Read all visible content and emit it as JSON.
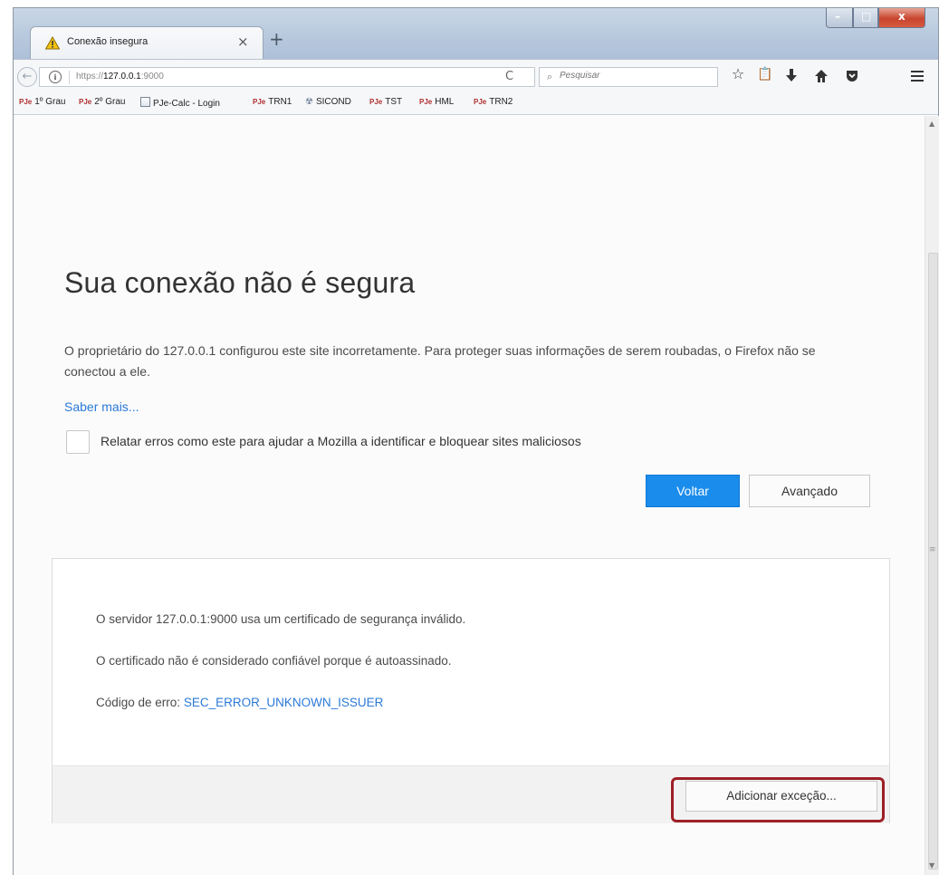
{
  "window": {
    "tab_title": "Conexão insegura",
    "tab_close": "×",
    "new_tab": "+",
    "controls": {
      "minimize": "–",
      "maximize": "□",
      "close": "x"
    }
  },
  "navbar": {
    "back_glyph": "←",
    "url_prefix": "https://",
    "url_host": "127.0.0.1",
    "url_port": ":9000",
    "reload_glyph": "C",
    "search_placeholder": "Pesquisar",
    "icons": [
      "star-icon",
      "clipboard-icon",
      "download-icon",
      "home-icon",
      "pocket-icon",
      "menu-icon"
    ]
  },
  "bookmarks": [
    {
      "icon": "pje",
      "label": "1º Grau"
    },
    {
      "icon": "pje",
      "label": "2º Grau"
    },
    {
      "icon": "page",
      "label": "PJe-Calc - Login"
    },
    {
      "icon": "pje",
      "label": "TRN1"
    },
    {
      "icon": "sicond",
      "label": "SICOND"
    },
    {
      "icon": "pje",
      "label": "TST"
    },
    {
      "icon": "pje",
      "label": "HML"
    },
    {
      "icon": "pje",
      "label": "TRN2"
    }
  ],
  "bookmark_icon_text": "PJe",
  "page": {
    "title": "Sua conexão não é segura",
    "description": "O proprietário do 127.0.0.1 configurou este site incorretamente. Para proteger suas informações de serem roubadas, o Firefox não se conectou a ele.",
    "learn_more": "Saber mais...",
    "report_label": "Relatar erros como este para ajudar a Mozilla a identificar e bloquear sites maliciosos",
    "back_button": "Voltar",
    "advanced_button": "Avançado"
  },
  "advanced": {
    "line1": "O servidor 127.0.0.1:9000 usa um certificado de segurança inválido.",
    "line2": "O certificado não é considerado confiável porque é autoassinado.",
    "error_label": "Código de erro: ",
    "error_code": "SEC_ERROR_UNKNOWN_ISSUER",
    "add_exception": "Adicionar exceção..."
  },
  "colors": {
    "accent": "#1a8cec",
    "link": "#2a7ad8",
    "highlight": "#9e1f26"
  }
}
